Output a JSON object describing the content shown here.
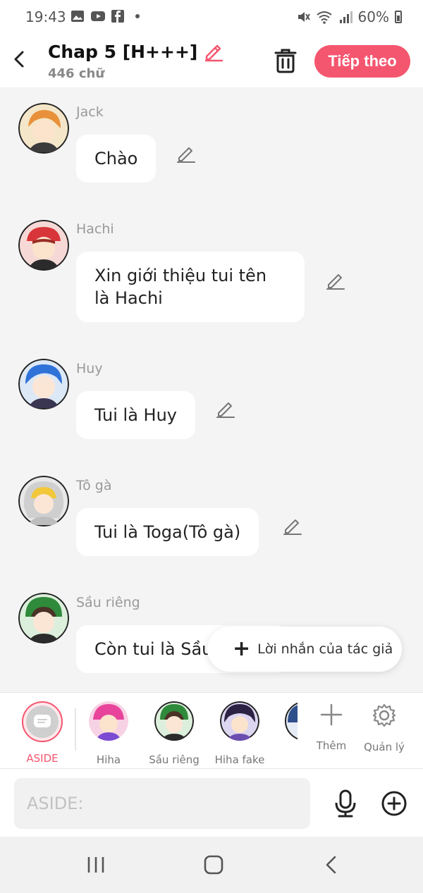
{
  "status_bar": {
    "time": "19:43",
    "battery": "60%"
  },
  "header": {
    "title": "Chap 5 [H+++]",
    "subtitle": "446 chữ",
    "next_label": "Tiếp theo"
  },
  "messages": [
    {
      "speaker": "Jack",
      "text": "Chào"
    },
    {
      "speaker": "Hachi",
      "text": "Xin giới thiệu tui tên là Hachi"
    },
    {
      "speaker": "Huy",
      "text": "Tui là Huy"
    },
    {
      "speaker": "Tô gà",
      "text": "Tui là Toga(Tô gà)"
    },
    {
      "speaker": "Sầu riêng",
      "text": "Còn tui là Sầu"
    }
  ],
  "author_note": {
    "label": "Lời nhắn của tác giả"
  },
  "characters": [
    {
      "name": "ASIDE",
      "color": "#f5566f"
    },
    {
      "name": "Hiha",
      "color": "#e8449b"
    },
    {
      "name": "Sầu riêng",
      "color": "#3d7d3b"
    },
    {
      "name": "Hiha fake",
      "color": "#4a3a7a"
    }
  ],
  "tools": {
    "add_label": "Thêm",
    "manage_label": "Quản lý"
  },
  "input": {
    "placeholder": "ASIDE:"
  },
  "colors": {
    "accent": "#f5566f"
  }
}
